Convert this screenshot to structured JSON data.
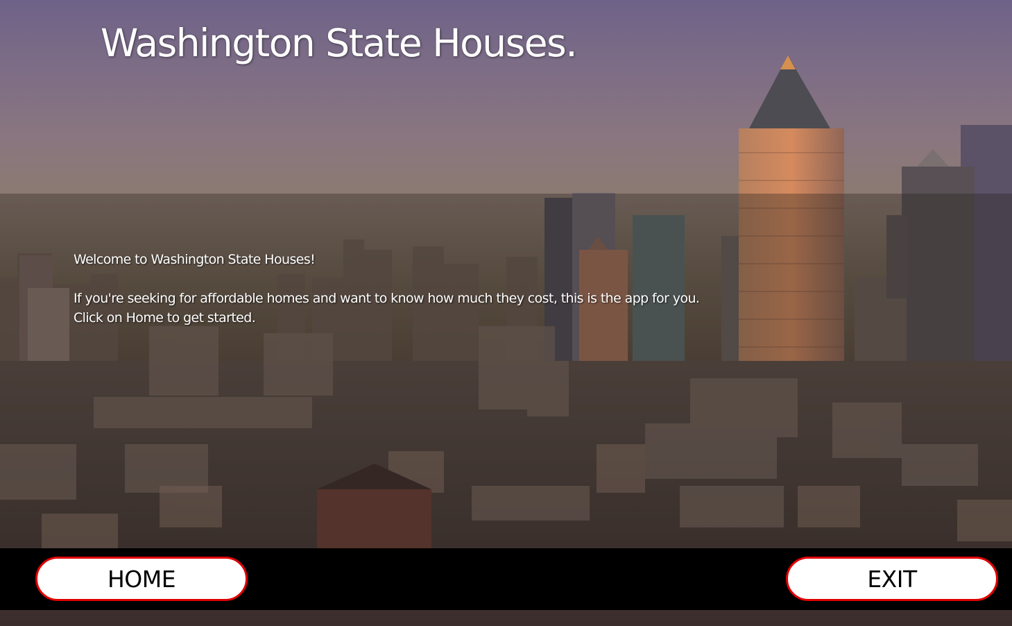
{
  "header": {
    "title": "Washington State Houses."
  },
  "welcome": {
    "greeting": "Welcome to Washington State Houses!",
    "line1": "If you're seeking for affordable homes and want to know how much they cost, this is the app for you.",
    "line2": "Click on Home to get started."
  },
  "footer": {
    "home_label": "HOME",
    "exit_label": "EXIT"
  },
  "colors": {
    "button_border": "#e00000",
    "button_background": "#ffffff",
    "footer_background": "#000000",
    "title_text": "#ffffff"
  }
}
